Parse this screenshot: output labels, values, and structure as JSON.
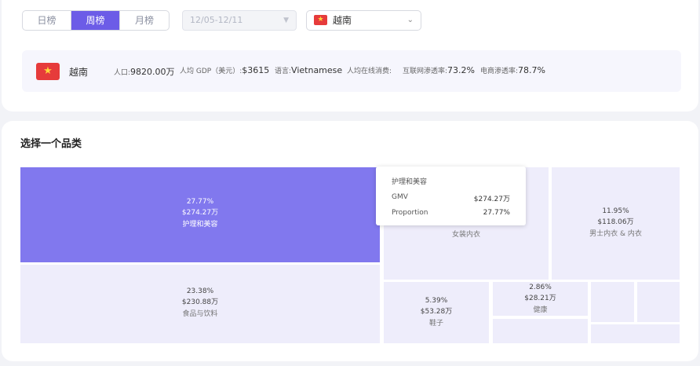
{
  "tabs": {
    "daily": "日榜",
    "weekly": "周榜",
    "monthly": "月榜",
    "active": "weekly"
  },
  "date_select": {
    "value": "12/05-12/11"
  },
  "country_select": {
    "value": "越南",
    "flag_icon": "vietnam-flag-icon"
  },
  "country_info": {
    "name": "越南",
    "population_label": "人口:",
    "population": "9820.00万",
    "gdp_label": "人均 GDP（美元）:",
    "gdp": "$3615",
    "language_label": "语言:",
    "language": "Vietnamese",
    "spend_label": "人均在线消费:",
    "spend": "",
    "internet_label": "互联网渗透率:",
    "internet": "73.2%",
    "ecommerce_label": "电商渗透率:",
    "ecommerce": "78.7%"
  },
  "section_title": "选择一个品类",
  "treemap": [
    {
      "pct": "27.77%",
      "value": "$274.27万",
      "name": "护理和美容"
    },
    {
      "pct": "23.38%",
      "value": "$230.88万",
      "name": "食品与饮料"
    },
    {
      "pct": "",
      "value": "",
      "name": "女装内衣"
    },
    {
      "pct": "11.95%",
      "value": "$118.06万",
      "name": "男士内衣 & 内衣"
    },
    {
      "pct": "5.39%",
      "value": "$53.28万",
      "name": "鞋子"
    },
    {
      "pct": "2.86%",
      "value": "$28.21万",
      "name": "健康"
    }
  ],
  "tooltip": {
    "title": "护理和美容",
    "rows": [
      {
        "label": "GMV",
        "value": "$274.27万"
      },
      {
        "label": "Proportion",
        "value": "27.77%"
      }
    ]
  },
  "colors": {
    "accent": "#6c5ce7",
    "active_tile": "#8178ee",
    "tile": "#eeedfb",
    "flag_red": "#e63b3b",
    "flag_star": "#ffd43b"
  }
}
